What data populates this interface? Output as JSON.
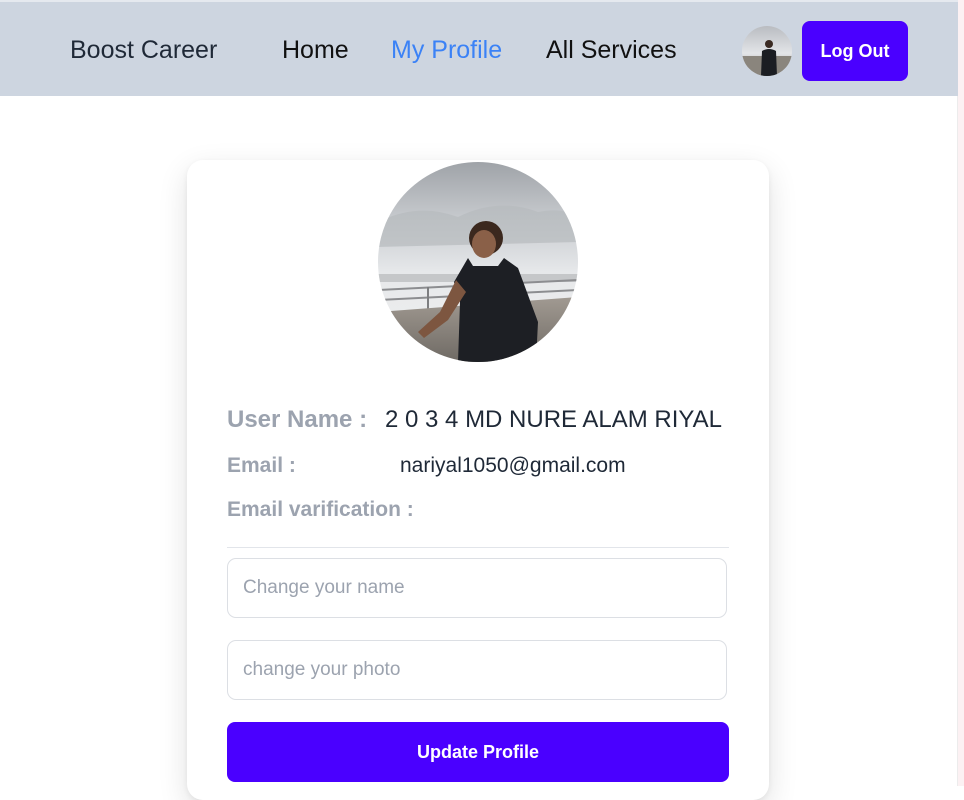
{
  "navbar": {
    "brand": "Boost Career",
    "links": [
      {
        "label": "Home",
        "active": false
      },
      {
        "label": "My Profile",
        "active": true
      },
      {
        "label": "All Services",
        "active": false
      }
    ],
    "logout_label": "Log Out",
    "accent_color": "#4a00ff",
    "active_link_color": "#3b82f6"
  },
  "profile": {
    "username_label": "User Name :",
    "username_value": "2 0 3 4 MD NURE ALAM RIYAL",
    "email_label": "Email :",
    "email_value": "nariyal1050@gmail.com",
    "verification_label": "Email varification :"
  },
  "form": {
    "name_placeholder": "Change your name",
    "photo_placeholder": "change your photo",
    "update_label": "Update Profile"
  }
}
